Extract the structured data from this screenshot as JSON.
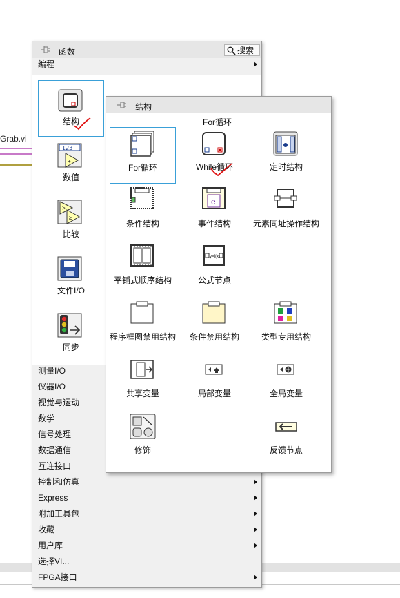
{
  "background": {
    "vi_label": "Grab.vi"
  },
  "palette": {
    "title": "函数",
    "search_label": "搜索",
    "category": "编程",
    "grid_items": [
      {
        "label": "结构"
      },
      {
        "label": "数值"
      },
      {
        "label": "比较"
      },
      {
        "label": "文件I/O"
      },
      {
        "label": "同步"
      }
    ],
    "lower_items": [
      {
        "label": "测量I/O",
        "submenu": false
      },
      {
        "label": "仪器I/O",
        "submenu": false
      },
      {
        "label": "视觉与运动",
        "submenu": false
      },
      {
        "label": "数学",
        "submenu": false
      },
      {
        "label": "信号处理",
        "submenu": false
      },
      {
        "label": "数据通信",
        "submenu": false
      },
      {
        "label": "互连接口",
        "submenu": false
      },
      {
        "label": "控制和仿真",
        "submenu": true
      },
      {
        "label": "Express",
        "submenu": true
      },
      {
        "label": "附加工具包",
        "submenu": true
      },
      {
        "label": "收藏",
        "submenu": true
      },
      {
        "label": "用户库",
        "submenu": true
      },
      {
        "label": "选择VI...",
        "submenu": false
      },
      {
        "label": "FPGA接口",
        "submenu": true
      }
    ]
  },
  "structures": {
    "title": "结构",
    "tooltip": "For循环",
    "items": [
      {
        "label": "For循环",
        "icon": "for-loop-icon"
      },
      {
        "label": "While循环",
        "icon": "while-loop-icon"
      },
      {
        "label": "定时结构",
        "icon": "timed-structure-icon"
      },
      {
        "label": "条件结构",
        "icon": "case-structure-icon"
      },
      {
        "label": "事件结构",
        "icon": "event-structure-icon"
      },
      {
        "label": "元素同址操作结构",
        "icon": "in-place-element-icon"
      },
      {
        "label": "平铺式顺序结构",
        "icon": "flat-sequence-icon"
      },
      {
        "label": "公式节点",
        "icon": "formula-node-icon"
      },
      {
        "label": "",
        "icon": ""
      },
      {
        "label": "程序框图禁用结构",
        "icon": "diagram-disable-icon"
      },
      {
        "label": "条件禁用结构",
        "icon": "conditional-disable-icon"
      },
      {
        "label": "类型专用结构",
        "icon": "type-specialization-icon"
      },
      {
        "label": "共享变量",
        "icon": "shared-variable-icon"
      },
      {
        "label": "局部变量",
        "icon": "local-variable-icon"
      },
      {
        "label": "全局变量",
        "icon": "global-variable-icon"
      },
      {
        "label": "修饰",
        "icon": "decorations-icon"
      },
      {
        "label": "",
        "icon": ""
      },
      {
        "label": "反馈节点",
        "icon": "feedback-node-icon"
      }
    ]
  }
}
